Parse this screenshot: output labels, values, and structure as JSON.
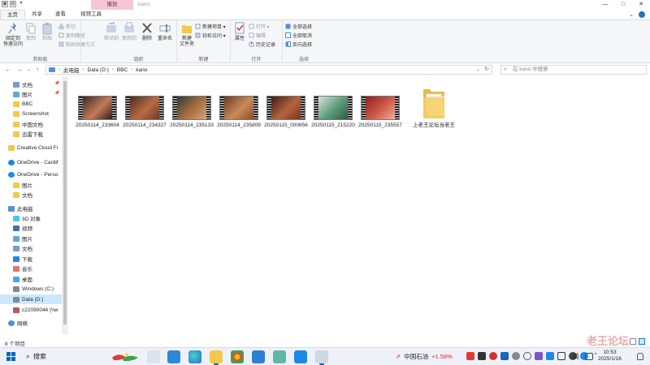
{
  "window": {
    "title": "kano",
    "context_tab": "播放",
    "controls": [
      "—",
      "□",
      "✕"
    ]
  },
  "ribbon_tabs": [
    {
      "label": "文件"
    },
    {
      "label": "主页"
    },
    {
      "label": "共享"
    },
    {
      "label": "查看"
    },
    {
      "label": "视频工具"
    }
  ],
  "ribbon": {
    "clipboard": {
      "label": "剪贴板",
      "pin": "固定到\n快速访问",
      "copy": "复制",
      "paste": "粘贴",
      "cut": "剪切",
      "copy_path": "复制路径",
      "paste_shortcut": "粘贴快捷方式"
    },
    "organize": {
      "label": "组织",
      "move_to": "移动到",
      "copy_to": "复制到",
      "delete": "删除",
      "rename": "重命名"
    },
    "new": {
      "label": "新建",
      "new_folder": "新建\n文件夹",
      "new_item": "新建项目 ▾",
      "easy_access": "轻松访问 ▾"
    },
    "open": {
      "label": "打开",
      "properties": "属性",
      "open": "打开 ▾",
      "edit": "编辑",
      "history": "历史记录"
    },
    "select": {
      "label": "选择",
      "select_all": "全部选择",
      "select_none": "全部取消",
      "invert": "反向选择"
    }
  },
  "address": {
    "crumbs": [
      "此电脑",
      "Data (D:)",
      "BBC",
      "kano"
    ],
    "search_placeholder": "在 kano 中搜索"
  },
  "nav": {
    "items": [
      {
        "label": "文档",
        "icon": "document-folder-icon",
        "pinned": true
      },
      {
        "label": "图片",
        "icon": "pictures-folder-icon",
        "pinned": true
      },
      {
        "label": "BBC",
        "icon": "folder-icon"
      },
      {
        "label": "Screenshot",
        "icon": "folder-icon"
      },
      {
        "label": "中国文档",
        "icon": "folder-icon"
      },
      {
        "label": "迅雷下载",
        "icon": "folder-icon"
      },
      {
        "label": "Creative Cloud Fi",
        "icon": "folder-icon"
      },
      {
        "label": "OneDrive - Cardif",
        "icon": "onedrive-icon"
      },
      {
        "label": "OneDrive - Perso",
        "icon": "onedrive-icon"
      },
      {
        "label": "图片",
        "icon": "folder-icon"
      },
      {
        "label": "文档",
        "icon": "folder-icon"
      },
      {
        "label": "此电脑",
        "icon": "computer-icon"
      },
      {
        "label": "3D 对象",
        "icon": "3d-objects-icon"
      },
      {
        "label": "视频",
        "icon": "video-folder-icon"
      },
      {
        "label": "图片",
        "icon": "pictures-folder-icon"
      },
      {
        "label": "文档",
        "icon": "document-folder-icon"
      },
      {
        "label": "下载",
        "icon": "download-folder-icon"
      },
      {
        "label": "音乐",
        "icon": "music-folder-icon"
      },
      {
        "label": "桌面",
        "icon": "desktop-folder-icon"
      },
      {
        "label": "Windows (C:)",
        "icon": "drive-icon"
      },
      {
        "label": "Data (D:)",
        "icon": "drive-icon",
        "selected": true
      },
      {
        "label": "c22090044 (\\\\w",
        "icon": "network-drive-icon"
      },
      {
        "label": "网络",
        "icon": "network-icon"
      }
    ]
  },
  "files": [
    {
      "name": "20250114_233604",
      "colors": [
        "#3a2a22",
        "#c47a5a",
        "#2b1d18"
      ]
    },
    {
      "name": "20250114_234327",
      "colors": [
        "#4a2d1f",
        "#b86b45",
        "#6e3b25"
      ]
    },
    {
      "name": "20250114_235133",
      "colors": [
        "#2e3a3a",
        "#a8703f",
        "#d9a27a"
      ]
    },
    {
      "name": "20250114_235809",
      "colors": [
        "#6b3b22",
        "#c98a5a",
        "#8a4e2c"
      ]
    },
    {
      "name": "20250115_000656",
      "colors": [
        "#3d1e14",
        "#b5633e",
        "#7a3520"
      ]
    },
    {
      "name": "20250115_215220",
      "colors": [
        "#d8e4dc",
        "#5a9a78",
        "#2e5a44"
      ]
    },
    {
      "name": "20250115_235557",
      "colors": [
        "#8a2020",
        "#d25a4a",
        "#f0b0a0"
      ]
    }
  ],
  "folder": {
    "name": "上老王论坛当老王"
  },
  "status": {
    "count": "8 个项目"
  },
  "taskbar": {
    "search_label": "搜索",
    "stock_name": "中国石油",
    "stock_change": "+1.58%",
    "lang": "英",
    "time": "10:53",
    "date": "2025/1/16",
    "watermark": "老王论坛",
    "colors": {
      "accent": "#0067c0",
      "stock_up": "#d32f2f"
    }
  }
}
